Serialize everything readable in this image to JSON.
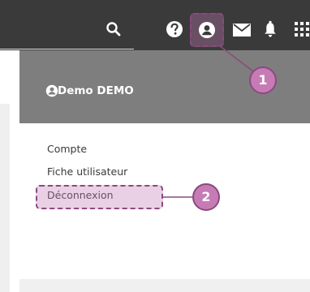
{
  "topbar": {
    "icons": [
      "search-icon",
      "help-icon",
      "account-icon",
      "mail-icon",
      "bell-icon",
      "apps-grid-icon"
    ]
  },
  "user_menu": {
    "user_name": "Demo DEMO",
    "items": [
      {
        "label": "Compte"
      },
      {
        "label": "Fiche utilisateur"
      },
      {
        "label": "Déconnexion"
      }
    ]
  },
  "callouts": [
    {
      "number": "1"
    },
    {
      "number": "2"
    }
  ],
  "colors": {
    "topbar": "#3a3a3a",
    "panel_header": "#7e7e7e",
    "callout": "#c77bb5",
    "callout_border": "#8a4a7e"
  }
}
